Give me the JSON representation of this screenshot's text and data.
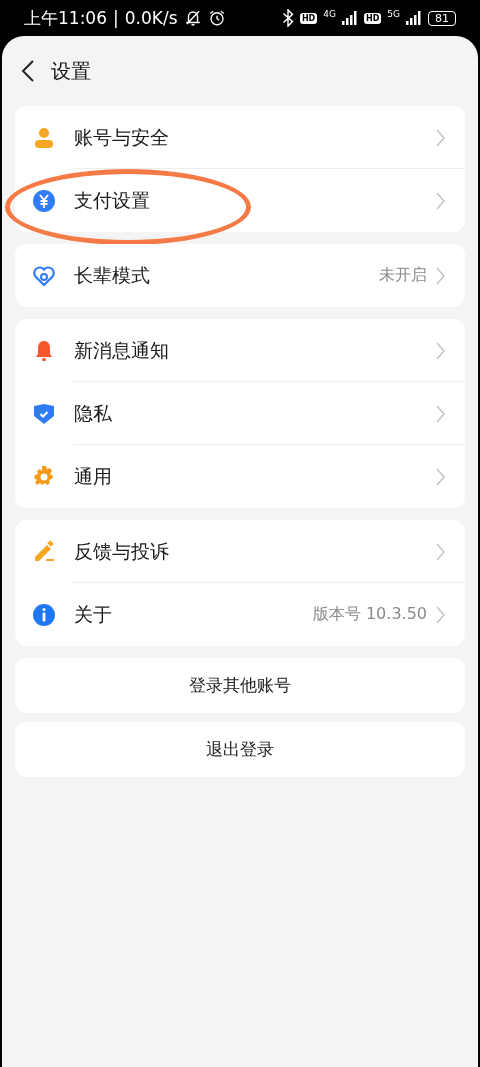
{
  "status_bar": {
    "time": "上午11:06",
    "separator": "|",
    "speed": "0.0K/s",
    "sims": [
      {
        "hd": "HD",
        "network": "4G"
      },
      {
        "hd": "HD",
        "network": "5G"
      }
    ],
    "battery": "81"
  },
  "header": {
    "title": "设置"
  },
  "groups": [
    {
      "items": [
        {
          "kind": "person",
          "label": "账号与安全",
          "highlighted": false
        },
        {
          "kind": "yen",
          "label": "支付设置",
          "highlighted": true
        }
      ]
    },
    {
      "items": [
        {
          "kind": "heart",
          "label": "长辈模式",
          "value": "未开启",
          "highlighted": false
        }
      ]
    },
    {
      "items": [
        {
          "kind": "bell",
          "label": "新消息通知",
          "highlighted": false
        },
        {
          "kind": "shield",
          "label": "隐私",
          "highlighted": false
        },
        {
          "kind": "gear",
          "label": "通用",
          "highlighted": false
        }
      ]
    },
    {
      "items": [
        {
          "kind": "pencil",
          "label": "反馈与投诉",
          "highlighted": false
        },
        {
          "kind": "info",
          "label": "关于",
          "value": "版本号 10.3.50",
          "highlighted": false
        }
      ]
    }
  ],
  "buttons": [
    "登录其他账号",
    "退出登录"
  ]
}
